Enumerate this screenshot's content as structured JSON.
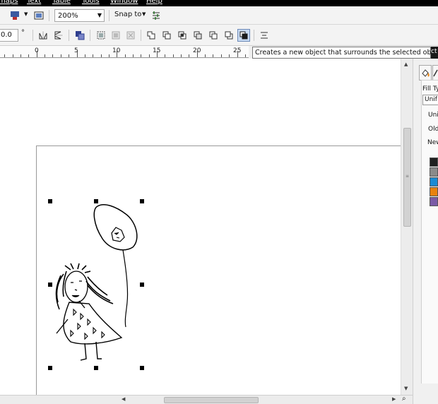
{
  "menu": {
    "items": [
      "maps",
      "Text",
      "Table",
      "Tools",
      "Window",
      "Help"
    ]
  },
  "toolbar1": {
    "zoom_value": "200%",
    "snap_to_label": "Snap to"
  },
  "toolbar2": {
    "rotation_value": "0.0",
    "degree_symbol": "°"
  },
  "ruler": {
    "labels": [
      "0",
      "5",
      "10",
      "15",
      "20",
      "25"
    ]
  },
  "tooltip": {
    "text": "Creates a new object that surrounds the selected objects",
    "overflow_fragment": "ct"
  },
  "docker": {
    "fill_type_label": "Fill Ty",
    "fill_type_value": "Unif",
    "uniform_label": "Unit",
    "old_label": "Old",
    "new_label": "New",
    "swatches": [
      "#1f1f1f",
      "#8a8a8a",
      "#1a8ad4",
      "#e8820e",
      "#7a5aa6"
    ]
  },
  "colors": {
    "menubar_bg": "#000000",
    "tooltip_border": "#767676"
  },
  "icons": {
    "fill_icon": "paint-bucket-icon",
    "outline_icon": "pen-icon",
    "zoom_icon": "magnifier-icon"
  }
}
